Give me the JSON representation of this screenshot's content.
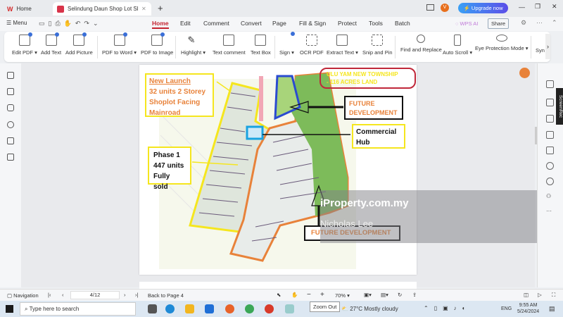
{
  "tabs": [
    {
      "label": "Home"
    },
    {
      "label": "Selindung Daun Shop Lot She"
    }
  ],
  "window": {
    "upgrade_label": "Upgrade now",
    "avatar_letter": "V"
  },
  "menu": {
    "label": "Menu",
    "tabs": [
      "Home",
      "Edit",
      "Comment",
      "Convert",
      "Page",
      "Fill & Sign",
      "Protect",
      "Tools",
      "Batch"
    ],
    "active": "Home",
    "wps_ai": "WPS AI",
    "share": "Share"
  },
  "ribbon": [
    {
      "label": "Edit PDF ▾",
      "icon": "edit-pdf-icon"
    },
    {
      "label": "Add Text",
      "icon": "add-text-icon"
    },
    {
      "label": "Add Picture",
      "icon": "add-picture-icon"
    },
    {
      "label": "PDF to Word ▾",
      "icon": "pdf-to-word-icon"
    },
    {
      "label": "PDF to Image",
      "icon": "pdf-to-image-icon"
    },
    {
      "label": "Highlight ▾",
      "icon": "highlight-icon"
    },
    {
      "label": "Text comment",
      "icon": "text-comment-icon"
    },
    {
      "label": "Text Box",
      "icon": "text-box-icon"
    },
    {
      "label": "Sign ▾",
      "icon": "sign-icon"
    },
    {
      "label": "OCR PDF",
      "icon": "ocr-icon"
    },
    {
      "label": "Extract Text ▾",
      "icon": "extract-text-icon"
    },
    {
      "label": "Snip and Pin",
      "icon": "snip-icon"
    },
    {
      "label": "Find and Replace",
      "icon": "search-icon"
    },
    {
      "label": "Auto Scroll ▾",
      "icon": "auto-scroll-icon"
    },
    {
      "label": "Eye Protection Mode ▾",
      "icon": "eye-icon"
    },
    {
      "label": "Syn",
      "icon": "sync-icon"
    }
  ],
  "map": {
    "title_line1": "ULU YAM NEW TOWNSHIP",
    "title_line2": "- 116 ACRES LAND",
    "new_launch": {
      "heading": "New Launch",
      "lines": [
        "32 units 2 Storey",
        "Shoplot Facing",
        "Mainroad"
      ]
    },
    "phase1": {
      "lines": [
        "Phase 1",
        "447 units",
        "Fully sold"
      ]
    },
    "future_top": [
      "FUTURE",
      "DEVELOPMENT"
    ],
    "commercial": [
      "Commercial",
      "Hub"
    ],
    "future_bottom": "FUTURE DEVELOPMENT",
    "watermark": "iProperty.com.my",
    "agent": "Nicholas Lee",
    "colors": {
      "yellow": "#f5e61e",
      "orange": "#e8823a",
      "blue": "#2a4bd0",
      "cyan": "#1aa3e0",
      "red": "#c0283a"
    }
  },
  "side_tag": "ScreenRec",
  "status": {
    "navigation": "Navigation",
    "page": "4/12",
    "back": "Back to Page 4",
    "zoom": "70%",
    "tooltip": "Zoom Out"
  },
  "taskbar": {
    "search_placeholder": "Type here to search",
    "weather": "27°C  Mostly cloudy",
    "lang": "ENG",
    "time": "9:55 AM",
    "date": "5/24/2024"
  }
}
